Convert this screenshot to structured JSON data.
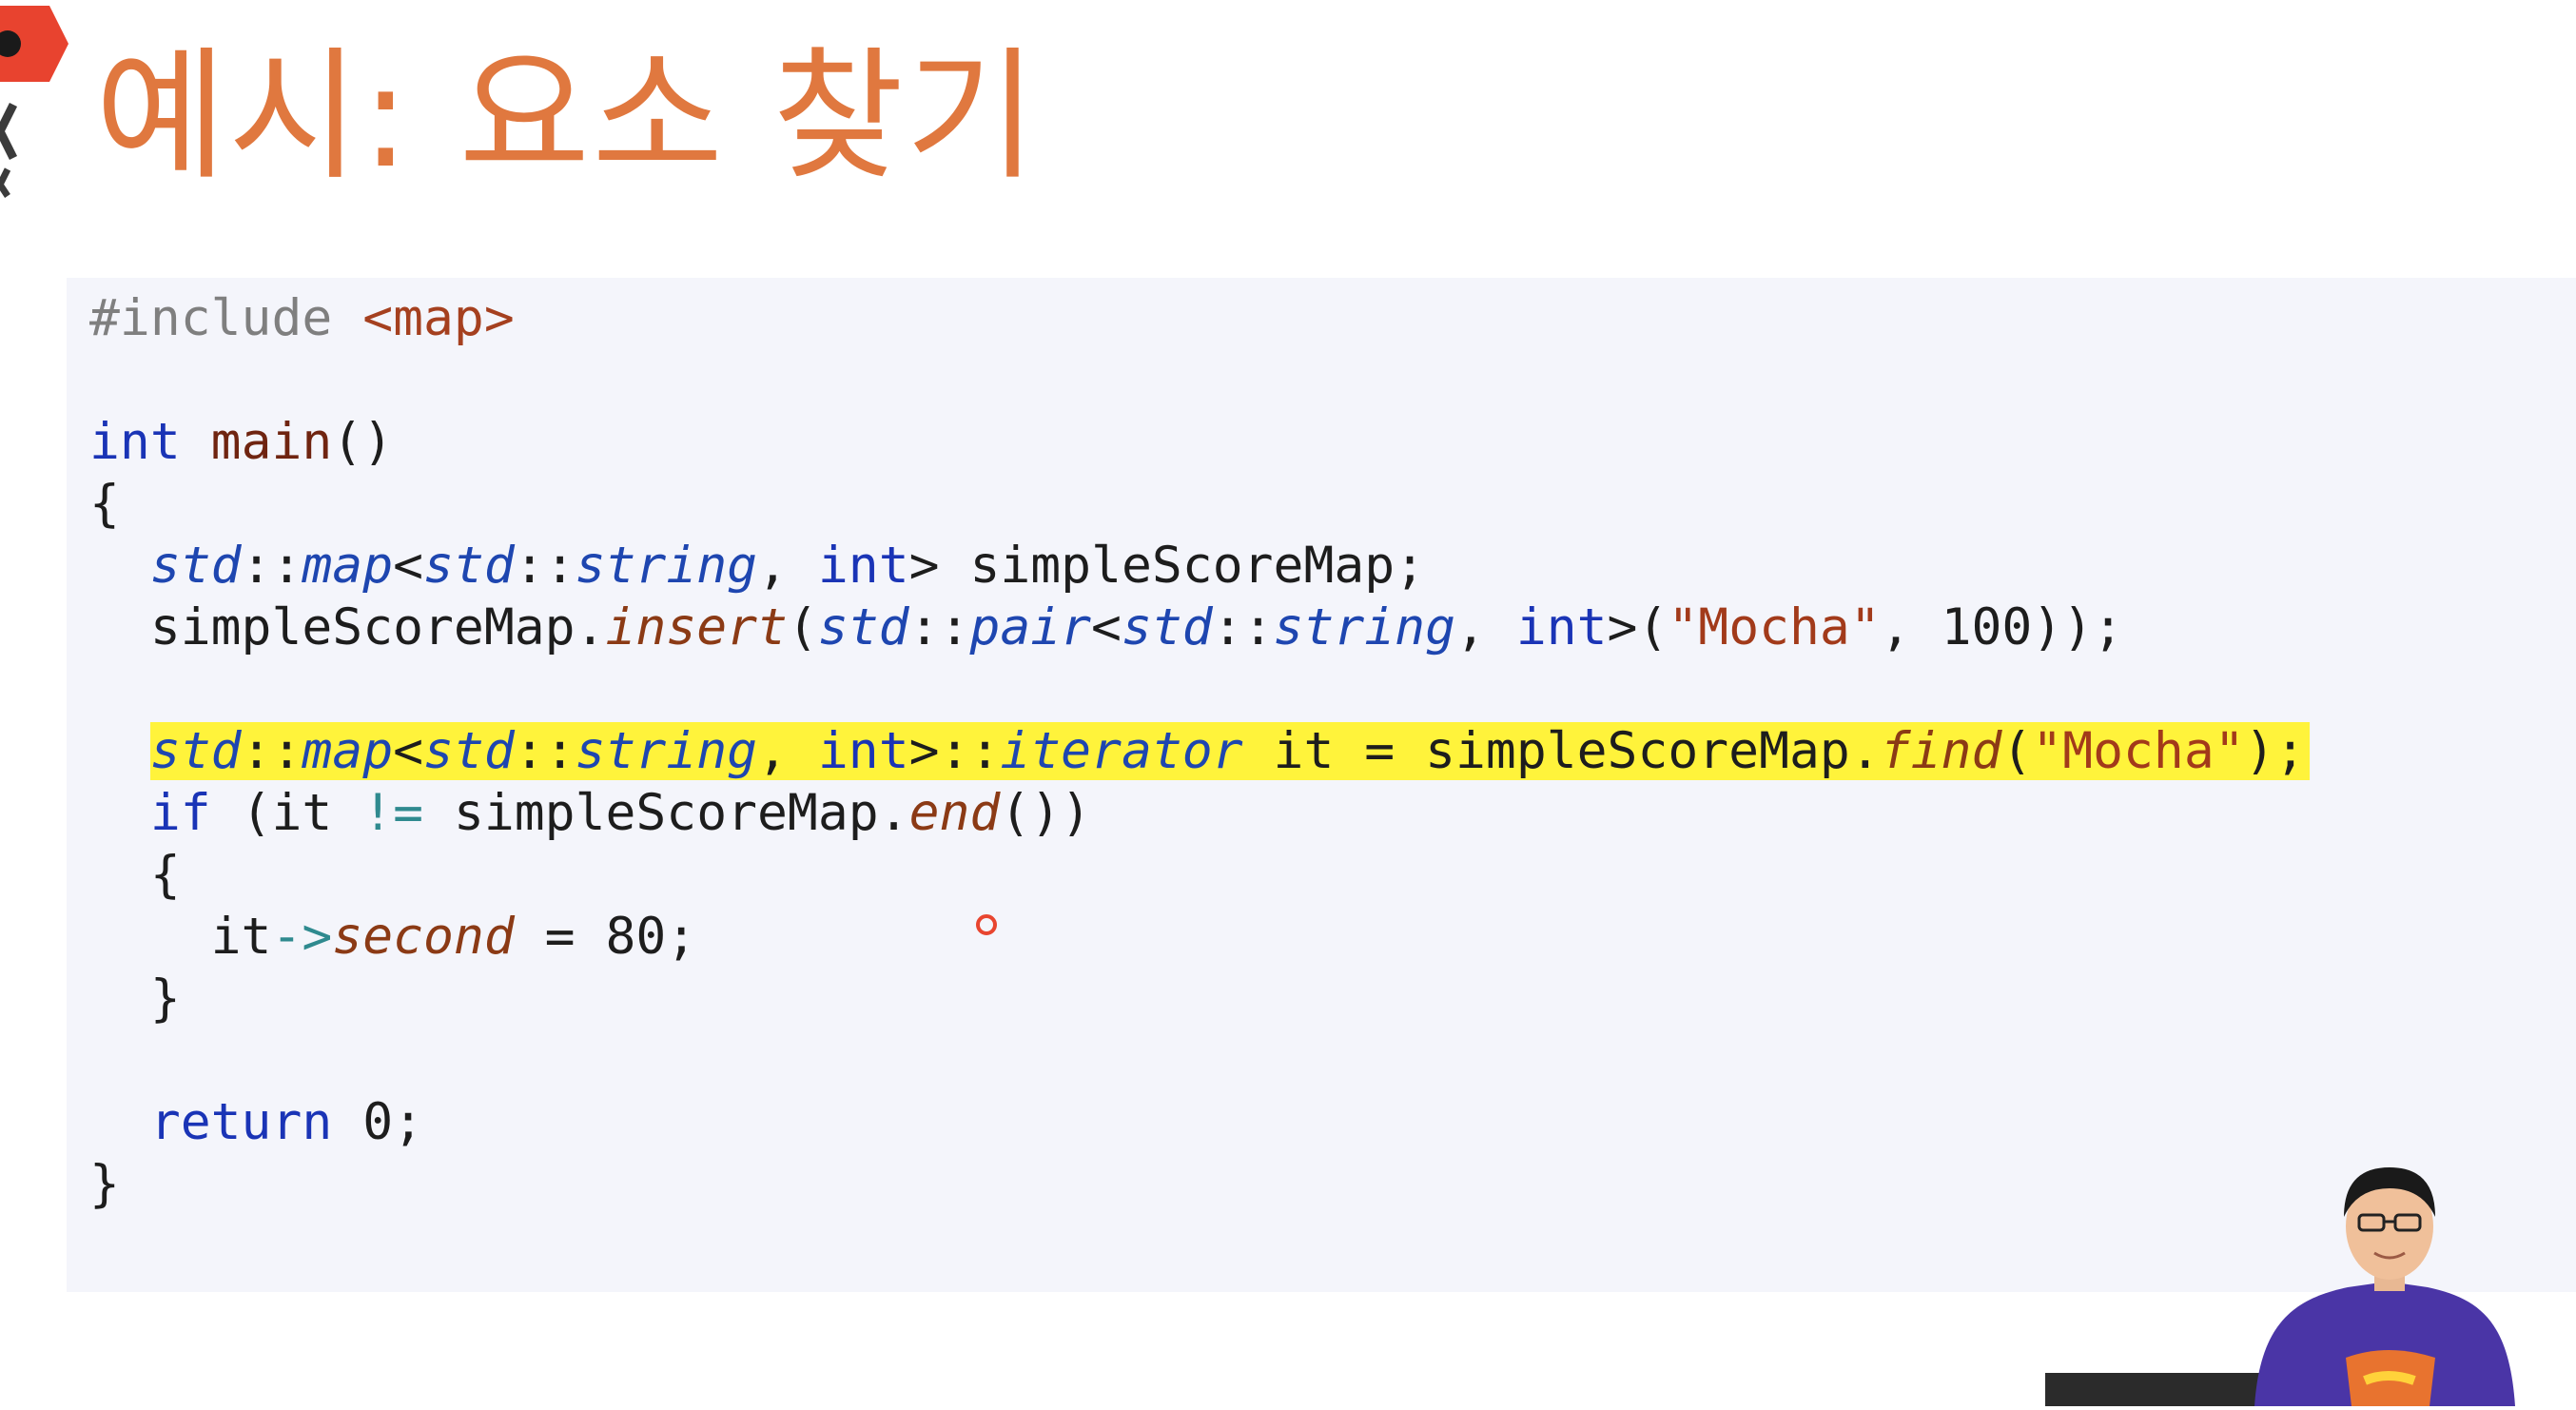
{
  "slide": {
    "title": "예시: 요소 찾기"
  },
  "code": {
    "lines": [
      {
        "indent": "",
        "tokens": [
          {
            "t": "#include ",
            "c": "pp"
          },
          {
            "t": "<map>",
            "c": "inc"
          }
        ]
      },
      {
        "indent": "",
        "tokens": []
      },
      {
        "indent": "",
        "tokens": [
          {
            "t": "int",
            "c": "kw"
          },
          {
            "t": " ",
            "c": "pl"
          },
          {
            "t": "main",
            "c": "fn"
          },
          {
            "t": "()",
            "c": "pl"
          }
        ]
      },
      {
        "indent": "",
        "tokens": [
          {
            "t": "{",
            "c": "pl"
          }
        ]
      },
      {
        "indent": "  ",
        "tokens": [
          {
            "t": "std",
            "c": "ns"
          },
          {
            "t": "::",
            "c": "pl"
          },
          {
            "t": "map",
            "c": "ty"
          },
          {
            "t": "<",
            "c": "pl"
          },
          {
            "t": "std",
            "c": "ns"
          },
          {
            "t": "::",
            "c": "pl"
          },
          {
            "t": "string",
            "c": "ty"
          },
          {
            "t": ", ",
            "c": "pl"
          },
          {
            "t": "int",
            "c": "kw"
          },
          {
            "t": "> simpleScoreMap;",
            "c": "pl"
          }
        ]
      },
      {
        "indent": "  ",
        "tokens": [
          {
            "t": "simpleScoreMap.",
            "c": "pl"
          },
          {
            "t": "insert",
            "c": "mem"
          },
          {
            "t": "(",
            "c": "pl"
          },
          {
            "t": "std",
            "c": "ns"
          },
          {
            "t": "::",
            "c": "pl"
          },
          {
            "t": "pair",
            "c": "ty"
          },
          {
            "t": "<",
            "c": "pl"
          },
          {
            "t": "std",
            "c": "ns"
          },
          {
            "t": "::",
            "c": "pl"
          },
          {
            "t": "string",
            "c": "ty"
          },
          {
            "t": ", ",
            "c": "pl"
          },
          {
            "t": "int",
            "c": "kw"
          },
          {
            "t": ">(",
            "c": "pl"
          },
          {
            "t": "\"Mocha\"",
            "c": "str"
          },
          {
            "t": ", 100));",
            "c": "pl"
          }
        ]
      },
      {
        "indent": "",
        "tokens": []
      },
      {
        "indent": "  ",
        "highlight": true,
        "tokens": [
          {
            "t": "std",
            "c": "ns"
          },
          {
            "t": "::",
            "c": "pl"
          },
          {
            "t": "map",
            "c": "ty"
          },
          {
            "t": "<",
            "c": "pl"
          },
          {
            "t": "std",
            "c": "ns"
          },
          {
            "t": "::",
            "c": "pl"
          },
          {
            "t": "string",
            "c": "ty"
          },
          {
            "t": ", ",
            "c": "pl"
          },
          {
            "t": "int",
            "c": "kw"
          },
          {
            "t": ">::",
            "c": "pl"
          },
          {
            "t": "iterator",
            "c": "ty"
          },
          {
            "t": " it = simpleScoreMap.",
            "c": "pl"
          },
          {
            "t": "find",
            "c": "mem"
          },
          {
            "t": "(",
            "c": "pl"
          },
          {
            "t": "\"Mocha\"",
            "c": "str"
          },
          {
            "t": ");",
            "c": "pl"
          }
        ]
      },
      {
        "indent": "  ",
        "tokens": [
          {
            "t": "if",
            "c": "kw"
          },
          {
            "t": " (it ",
            "c": "pl"
          },
          {
            "t": "!=",
            "c": "op"
          },
          {
            "t": " simpleScoreMap.",
            "c": "pl"
          },
          {
            "t": "end",
            "c": "mem"
          },
          {
            "t": "())",
            "c": "pl"
          }
        ]
      },
      {
        "indent": "  ",
        "tokens": [
          {
            "t": "{",
            "c": "pl"
          }
        ]
      },
      {
        "indent": "    ",
        "tokens": [
          {
            "t": "it",
            "c": "pl"
          },
          {
            "t": "->",
            "c": "op"
          },
          {
            "t": "second",
            "c": "mem"
          },
          {
            "t": " = 80;",
            "c": "pl"
          }
        ]
      },
      {
        "indent": "  ",
        "tokens": [
          {
            "t": "}",
            "c": "pl"
          }
        ]
      },
      {
        "indent": "",
        "tokens": []
      },
      {
        "indent": "  ",
        "tokens": [
          {
            "t": "return",
            "c": "kw"
          },
          {
            "t": " 0;",
            "c": "pl"
          }
        ]
      },
      {
        "indent": "",
        "tokens": [
          {
            "t": "}",
            "c": "pl"
          }
        ]
      }
    ]
  },
  "colors": {
    "title": "#e0783f",
    "code_background": "#f4f5fb",
    "highlight": "#fff33b",
    "keyword": "#1a34b6",
    "string": "#a23a1a",
    "cursor": "#e8452f"
  },
  "icons": {
    "corner_logo": "pocu-academy-logo-icon",
    "presenter": "presenter-video-thumbnail"
  }
}
